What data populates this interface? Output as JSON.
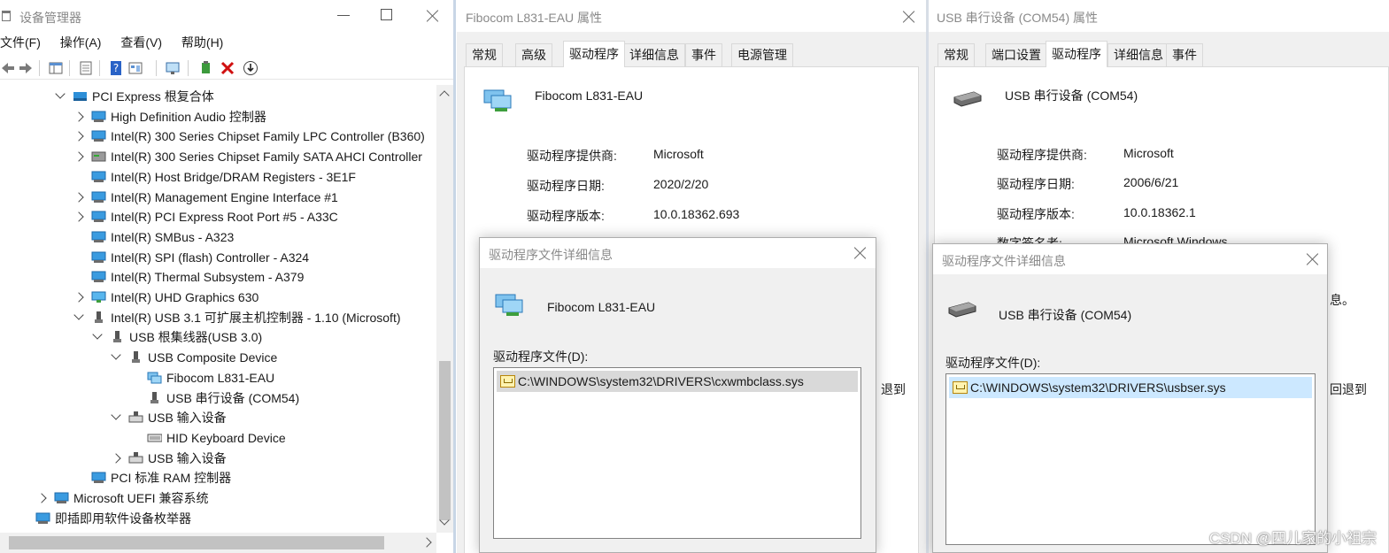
{
  "device_manager": {
    "title": "设备管理器",
    "menu": [
      "文件(F)",
      "操作(A)",
      "查看(V)",
      "帮助(H)"
    ],
    "toolbar_icons": [
      "back-icon",
      "forward-icon",
      "console-tree-icon",
      "properties-icon",
      "help-icon",
      "view-icon",
      "monitor-icon",
      "update-driver-icon",
      "uninstall-icon",
      "download-icon"
    ],
    "tree": [
      {
        "label": "PCI Express 根复合体",
        "level": 0,
        "expander": "expanded",
        "icon": "folder"
      },
      {
        "label": "High Definition Audio 控制器",
        "level": 1,
        "expander": "collapsed",
        "icon": "device"
      },
      {
        "label": "Intel(R) 300 Series Chipset Family LPC Controller (B360)",
        "level": 1,
        "expander": "collapsed",
        "icon": "device"
      },
      {
        "label": "Intel(R) 300 Series Chipset Family SATA AHCI Controller",
        "level": 1,
        "expander": "collapsed",
        "icon": "storage"
      },
      {
        "label": "Intel(R) Host Bridge/DRAM Registers - 3E1F",
        "level": 1,
        "expander": "none",
        "icon": "device"
      },
      {
        "label": "Intel(R) Management Engine Interface #1",
        "level": 1,
        "expander": "collapsed",
        "icon": "device"
      },
      {
        "label": "Intel(R) PCI Express Root Port #5 - A33C",
        "level": 1,
        "expander": "collapsed",
        "icon": "device"
      },
      {
        "label": "Intel(R) SMBus - A323",
        "level": 1,
        "expander": "none",
        "icon": "device"
      },
      {
        "label": "Intel(R) SPI (flash) Controller - A324",
        "level": 1,
        "expander": "none",
        "icon": "device"
      },
      {
        "label": "Intel(R) Thermal Subsystem - A379",
        "level": 1,
        "expander": "none",
        "icon": "device"
      },
      {
        "label": "Intel(R) UHD Graphics 630",
        "level": 1,
        "expander": "collapsed",
        "icon": "display"
      },
      {
        "label": "Intel(R) USB 3.1 可扩展主机控制器 - 1.10 (Microsoft)",
        "level": 1,
        "expander": "expanded",
        "icon": "usb"
      },
      {
        "label": "USB 根集线器(USB 3.0)",
        "level": 2,
        "expander": "expanded",
        "icon": "usb"
      },
      {
        "label": "USB Composite Device",
        "level": 3,
        "expander": "expanded",
        "icon": "usb"
      },
      {
        "label": "Fibocom L831-EAU",
        "level": 4,
        "expander": "none",
        "icon": "network"
      },
      {
        "label": "USB 串行设备 (COM54)",
        "level": 4,
        "expander": "none",
        "icon": "usb"
      },
      {
        "label": "USB 输入设备",
        "level": 3,
        "expander": "expanded",
        "icon": "hid"
      },
      {
        "label": "HID Keyboard Device",
        "level": 4,
        "expander": "none",
        "icon": "keyboard"
      },
      {
        "label": "USB 输入设备",
        "level": 3,
        "expander": "collapsed",
        "icon": "hid"
      },
      {
        "label": "PCI 标准 RAM 控制器",
        "level": 1,
        "expander": "none",
        "icon": "device"
      },
      {
        "label": "Microsoft UEFI 兼容系统",
        "level": -1,
        "expander": "collapsed",
        "icon": "device"
      },
      {
        "label": "即插即用软件设备枚举器",
        "level": -2,
        "expander": "none",
        "icon": "device"
      }
    ]
  },
  "fibocom_props": {
    "title": "Fibocom L831-EAU 属性",
    "tabs": [
      "常规",
      "高级",
      "驱动程序",
      "详细信息",
      "事件",
      "电源管理"
    ],
    "active_tab": "驱动程序",
    "device_name": "Fibocom L831-EAU",
    "fields": [
      {
        "label": "驱动程序提供商:",
        "value": "Microsoft"
      },
      {
        "label": "驱动程序日期:",
        "value": "2020/2/20"
      },
      {
        "label": "驱动程序版本:",
        "value": "10.0.18362.693"
      }
    ],
    "peek_text": [
      "退到"
    ]
  },
  "fibocom_files": {
    "title": "驱动程序文件详细信息",
    "device_name": "Fibocom L831-EAU",
    "files_label": "驱动程序文件(D):",
    "files": [
      "C:\\WINDOWS\\system32\\DRIVERS\\cxwmbclass.sys"
    ]
  },
  "usb_props": {
    "title": "USB 串行设备 (COM54) 属性",
    "tabs": [
      "常规",
      "端口设置",
      "驱动程序",
      "详细信息",
      "事件"
    ],
    "active_tab": "驱动程序",
    "device_name": "USB 串行设备 (COM54)",
    "fields": [
      {
        "label": "驱动程序提供商:",
        "value": "Microsoft"
      },
      {
        "label": "驱动程序日期:",
        "value": "2006/6/21"
      },
      {
        "label": "驱动程序版本:",
        "value": "10.0.18362.1"
      }
    ],
    "partial_row": {
      "label": "数字签名者:",
      "value": "Microsoft Windows"
    },
    "peek_text": [
      "息。",
      "回退到"
    ]
  },
  "usb_files": {
    "title": "驱动程序文件详细信息",
    "device_name": "USB 串行设备 (COM54)",
    "files_label": "驱动程序文件(D):",
    "files": [
      "C:\\WINDOWS\\system32\\DRIVERS\\usbser.sys"
    ]
  },
  "watermark": "CSDN @四儿家的小祖宗",
  "colors": {
    "selection": "#cce8ff",
    "selection_gray": "#d9d9d9",
    "tree_icon_blue": "#1e88d0",
    "uninstall_red": "#d01010",
    "tab_border": "#d9d9d9"
  }
}
